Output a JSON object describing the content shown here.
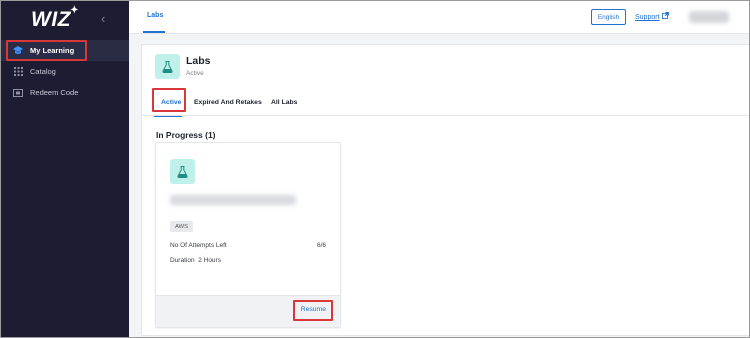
{
  "sidebar": {
    "logo": "WIZ",
    "logo_mark": "✦",
    "collapse_glyph": "‹",
    "items": [
      {
        "label": "My Learning",
        "icon": "graduation-cap-icon",
        "active": true
      },
      {
        "label": "Catalog",
        "icon": "grid-icon",
        "active": false
      },
      {
        "label": "Redeem Code",
        "icon": "ticket-icon",
        "active": false
      }
    ]
  },
  "topbar": {
    "breadcrumb": "Labs",
    "language": "English",
    "support": "Support",
    "support_icon": "external-link-icon"
  },
  "header": {
    "title": "Labs",
    "status": "Active",
    "icon": "flask-icon"
  },
  "tabs": [
    {
      "label": "Active",
      "active": true
    },
    {
      "label": "Expired And Retakes",
      "active": false
    },
    {
      "label": "All Labs",
      "active": false
    }
  ],
  "section": {
    "title": "In Progress (1)"
  },
  "card": {
    "icon": "flask-icon",
    "tag": "AWS",
    "attempts_label": "No Of Attempts Left",
    "attempts_value": "6/6",
    "duration_label": "Duration",
    "duration_value": "2 Hours",
    "action": "Resume"
  },
  "colors": {
    "sidebar_bg": "#1c1d33",
    "accent": "#2474cf",
    "icon_bg": "#bff0ea",
    "highlight": "#d9383a"
  }
}
